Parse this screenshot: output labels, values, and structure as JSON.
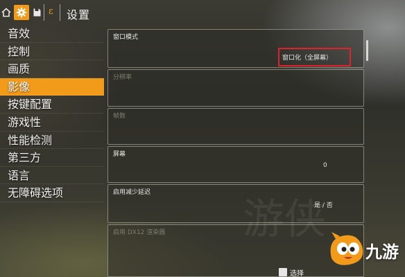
{
  "header": {
    "title": "设置",
    "e_glyph": "ε"
  },
  "sidebar": {
    "items": [
      {
        "label": "音效"
      },
      {
        "label": "控制"
      },
      {
        "label": "画质"
      },
      {
        "label": "影像",
        "active": true
      },
      {
        "label": "按键配置"
      },
      {
        "label": "游戏性"
      },
      {
        "label": "性能检测"
      },
      {
        "label": "第三方"
      },
      {
        "label": "语言"
      },
      {
        "label": "无障碍选项"
      }
    ]
  },
  "settings": [
    {
      "label": "窗口模式",
      "value": "窗口化（全屏幕）",
      "enabled": true,
      "highlighted": true
    },
    {
      "label": "分辨率",
      "value": "",
      "enabled": false
    },
    {
      "label": "帧数",
      "value": "",
      "enabled": false
    },
    {
      "label": "屏幕",
      "value": "0",
      "enabled": true
    },
    {
      "label": "启用减少延迟",
      "value": "是 / 否",
      "enabled": true
    },
    {
      "label": "启用 DX12 渲染器",
      "value": "",
      "enabled": false
    }
  ],
  "watermark": {
    "brand": "九游",
    "faint_text": "游侠"
  },
  "footer_hint": {
    "label": "选择"
  },
  "colors": {
    "accent": "#f29a1a",
    "highlight_box": "#e0232a"
  }
}
